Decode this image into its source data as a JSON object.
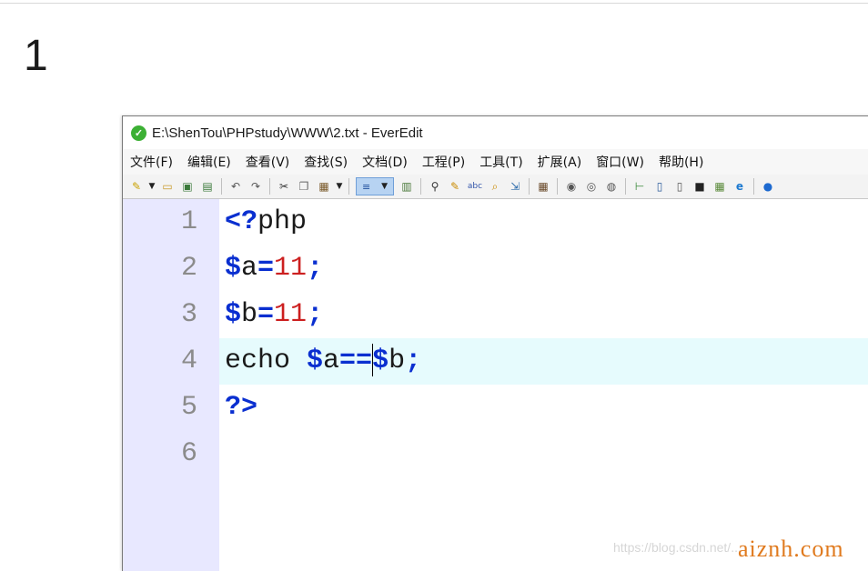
{
  "page_number": "1",
  "window": {
    "title": "E:\\ShenTou\\PHPstudy\\WWW\\2.txt - EverEdit"
  },
  "menubar": {
    "items": [
      "文件(F)",
      "编辑(E)",
      "查看(V)",
      "查找(S)",
      "文档(D)",
      "工程(P)",
      "工具(T)",
      "扩展(A)",
      "窗口(W)",
      "帮助(H)"
    ]
  },
  "toolbar": {
    "icons": [
      "new-file-icon",
      "open-icon",
      "save-icon",
      "save-all-icon",
      "undo-icon",
      "redo-icon",
      "cut-icon",
      "copy-icon",
      "paste-icon",
      "word-wrap-icon",
      "column-mode-icon",
      "find-icon",
      "replace-icon",
      "spell-check-icon",
      "find-in-files-icon",
      "goto-icon",
      "macro-icon",
      "record-icon",
      "play-icon",
      "play-many-icon",
      "tree-icon",
      "panel-icon",
      "split-icon",
      "terminal-icon",
      "grid-icon",
      "browser-icon",
      "help-icon"
    ]
  },
  "editor": {
    "line_numbers": [
      "1",
      "2",
      "3",
      "4",
      "5",
      "6"
    ],
    "current_line": 4,
    "lines": [
      [
        {
          "t": "<?",
          "c": "kw"
        },
        {
          "t": "php",
          "c": ""
        }
      ],
      [
        {
          "t": "$",
          "c": "kw"
        },
        {
          "t": "a",
          "c": ""
        },
        {
          "t": "=",
          "c": "kw"
        },
        {
          "t": "11",
          "c": "num"
        },
        {
          "t": ";",
          "c": "kw"
        }
      ],
      [
        {
          "t": "$",
          "c": "kw"
        },
        {
          "t": "b",
          "c": ""
        },
        {
          "t": "=",
          "c": "kw"
        },
        {
          "t": "11",
          "c": "num"
        },
        {
          "t": ";",
          "c": "kw"
        }
      ],
      [
        {
          "t": "echo ",
          "c": ""
        },
        {
          "t": "$",
          "c": "kw"
        },
        {
          "t": "a",
          "c": ""
        },
        {
          "t": "==",
          "c": "kw"
        },
        {
          "t": "|",
          "c": "caret"
        },
        {
          "t": "$",
          "c": "kw"
        },
        {
          "t": "b",
          "c": ""
        },
        {
          "t": ";",
          "c": "kw"
        }
      ],
      [
        {
          "t": "?>",
          "c": "kw"
        }
      ],
      []
    ]
  },
  "watermark": {
    "url": "https://blog.csdn.net/...",
    "brand": "aiznh.com"
  }
}
